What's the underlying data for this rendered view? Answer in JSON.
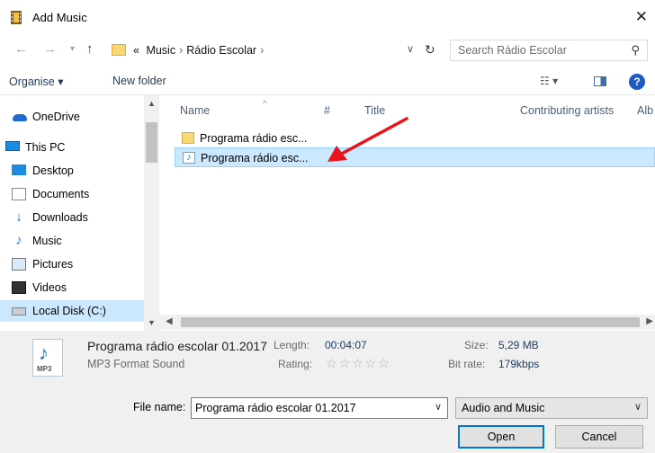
{
  "window": {
    "title": "Add Music",
    "close_glyph": "✕"
  },
  "address": {
    "crumbs": [
      "«",
      "Music",
      "Rádio Escolar"
    ],
    "search_placeholder": "Search Rádio Escolar"
  },
  "toolbar": {
    "organise": "Organise ▾",
    "new_folder": "New folder",
    "help": "?"
  },
  "nav": {
    "items": [
      {
        "label": "OneDrive",
        "icon": "onedrive-icon"
      },
      {
        "label": "This PC",
        "icon": "pc-icon"
      },
      {
        "label": "Desktop",
        "icon": "desktop-icon"
      },
      {
        "label": "Documents",
        "icon": "documents-icon"
      },
      {
        "label": "Downloads",
        "icon": "downloads-icon"
      },
      {
        "label": "Music",
        "icon": "music-icon"
      },
      {
        "label": "Pictures",
        "icon": "pictures-icon"
      },
      {
        "label": "Videos",
        "icon": "videos-icon"
      },
      {
        "label": "Local Disk (C:)",
        "icon": "disk-icon"
      }
    ]
  },
  "columns": {
    "name": "Name",
    "number": "#",
    "title": "Title",
    "artists": "Contributing artists",
    "album": "Alb"
  },
  "files": [
    {
      "name": "Programa rádio esc...",
      "type": "folder",
      "selected": false
    },
    {
      "name": "Programa rádio esc...",
      "type": "mp3",
      "selected": true
    }
  ],
  "details": {
    "name": "Programa rádio escolar 01.2017",
    "type": "MP3 Format Sound",
    "length_label": "Length:",
    "length": "00:04:07",
    "rating_label": "Rating:",
    "rating_stars": "☆☆☆☆☆",
    "size_label": "Size:",
    "size": "5,29 MB",
    "bitrate_label": "Bit rate:",
    "bitrate": "179kbps",
    "icon_tag": "MP3"
  },
  "bottom": {
    "file_name_label": "File name:",
    "file_name_value": "Programa rádio escolar 01.2017",
    "file_type_value": "Audio and Music",
    "open_label": "Open",
    "cancel_label": "Cancel"
  },
  "colors": {
    "selection": "#cce8ff",
    "accent": "#0078d7",
    "annotation": "#e8141a"
  }
}
